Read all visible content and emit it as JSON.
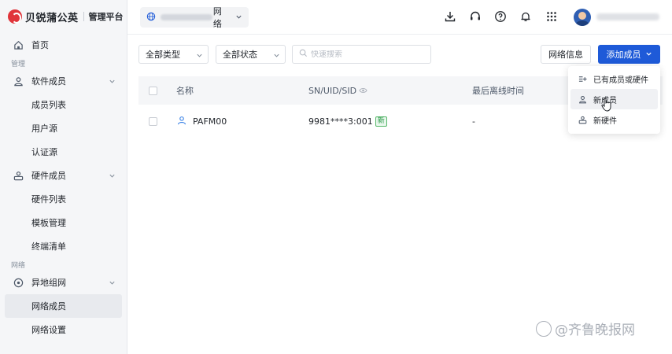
{
  "brand": {
    "name": "贝锐蒲公英",
    "subtitle": "管理平台"
  },
  "sidebar": {
    "home": "首页",
    "group_manage": "管理",
    "software_members": "软件成员",
    "member_list": "成员列表",
    "user_source": "用户源",
    "auth_source": "认证源",
    "hardware_members": "硬件成员",
    "hardware_list": "硬件列表",
    "template_manage": "模板管理",
    "terminal_list": "终端清单",
    "group_network": "网络",
    "remote_network": "异地组网",
    "network_members": "网络成员",
    "network_settings": "网络设置"
  },
  "topbar": {
    "network_label": "网络"
  },
  "filters": {
    "type": "全部类型",
    "status": "全部状态",
    "search_placeholder": "快速搜索"
  },
  "actions": {
    "network_info": "网络信息",
    "add_member": "添加成员"
  },
  "table": {
    "headers": {
      "name": "名称",
      "sn": "SN/UID/SID",
      "last_offline": "最后离线时间"
    },
    "rows": [
      {
        "name": "PAFM00",
        "sn": "9981****3:001",
        "tag": "新",
        "last_offline": "-"
      }
    ]
  },
  "dropdown": {
    "items": [
      "已有成员或硬件",
      "新成员",
      "新硬件"
    ]
  },
  "watermark": "@齐鲁晚报网",
  "colors": {
    "primary": "#1e5ad8",
    "brand": "#e0343a",
    "tag_green": "#2b9a48"
  }
}
